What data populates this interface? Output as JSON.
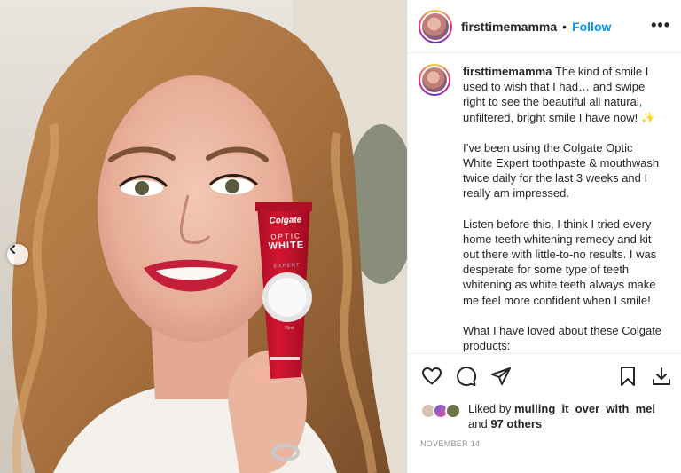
{
  "post": {
    "username": "firsttimemamma",
    "separator": "•",
    "follow_label": "Follow",
    "more_icon": "more-horizontal-icon",
    "caption": {
      "p1": "The kind of smile I used to wish that I had… and swipe right to see the beautiful all natural, unfiltered, bright smile I have now! ✨",
      "p2": "I’ve been using the Colgate Optic White Expert toothpaste & mouthwash twice daily for the last 3 weeks and I really am impressed.",
      "p3": "Listen before this, I think I tried every home teeth whitening remedy and kit out there with little-to-no results. I was desperate for some type of teeth whitening as white teeth always make me feel more confident when I smile!",
      "p4": "What I have loved about these Colgate products:"
    },
    "likes": {
      "prefix": "Liked by",
      "user": "mulling_it_over_with_mel",
      "joiner": "and",
      "others": "97 others"
    },
    "date": "NOVEMBER 14"
  },
  "product": {
    "brand": "Colgate",
    "line1": "OPTIC",
    "line2": "WHITE",
    "variant": "EXPERT",
    "size": "75ml"
  },
  "colors": {
    "accent_blue": "#0095f6",
    "tube_red": "#c8102e",
    "lip_red": "#c41e3a"
  }
}
